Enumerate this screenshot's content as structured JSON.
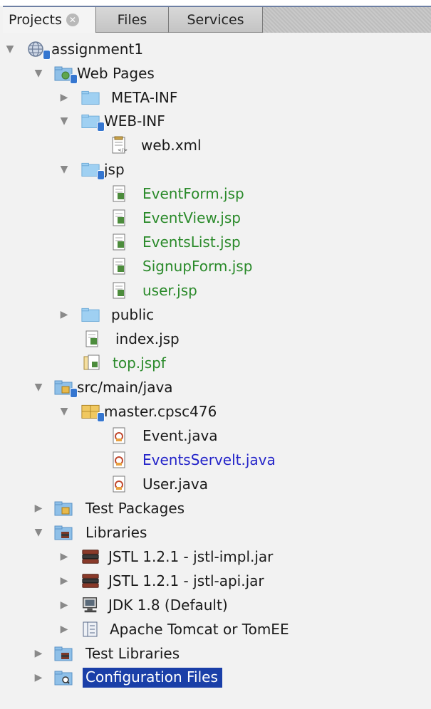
{
  "tabs": {
    "projects": "Projects",
    "files": "Files",
    "services": "Services"
  },
  "tree": {
    "project": "assignment1",
    "web_pages": "Web Pages",
    "meta_inf": "META-INF",
    "web_inf": "WEB-INF",
    "web_xml": "web.xml",
    "jsp": "jsp",
    "event_form": "EventForm.jsp",
    "event_view": "EventView.jsp",
    "events_list": "EventsList.jsp",
    "signup_form": "SignupForm.jsp",
    "user_jsp": "user.jsp",
    "public": "public",
    "index_jsp": "index.jsp",
    "top_jspf": "top.jspf",
    "src_main_java": "src/main/java",
    "package": "master.cpsc476",
    "event_java": "Event.java",
    "events_servelt": "EventsServelt.java",
    "user_java": "User.java",
    "test_packages": "Test Packages",
    "libraries": "Libraries",
    "jstl_impl": "JSTL 1.2.1 - jstl-impl.jar",
    "jstl_api": "JSTL 1.2.1 - jstl-api.jar",
    "jdk": "JDK 1.8 (Default)",
    "tomcat": "Apache Tomcat or TomEE",
    "test_libraries": "Test Libraries",
    "config_files": "Configuration Files"
  },
  "colors": {
    "modified_file": "#2a8a2a",
    "changed_file": "#2424c9",
    "selection": "#1a3fa8"
  }
}
